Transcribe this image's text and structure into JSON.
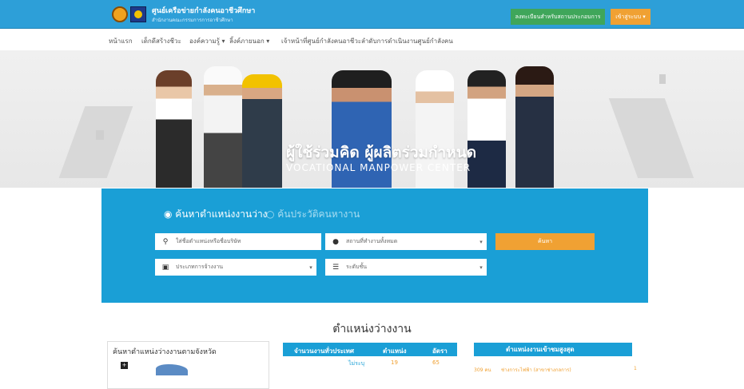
{
  "header": {
    "title": "ศูนย์เครือข่ายกำลังคนอาชีวศึกษา",
    "subtitle": "สำนักงานคณะกรรมการการอาชีวศึกษา",
    "register_label": "ลงทะเบียนสำหรับสถานประกอบการ",
    "login_label": "เข้าสู่ระบบ ▾"
  },
  "nav": {
    "items": [
      {
        "label": "หน้าแรก"
      },
      {
        "label": "เด็กดีสร้างชีวะ"
      },
      {
        "label": "องค์ความรู้ ▾"
      },
      {
        "label": "ลิ้งค์ภายนอก ▾"
      },
      {
        "label": "เจ้าหน้าที่ศูนย์กำลังคนอาชีวะ"
      },
      {
        "label": "ลำดับการดำเนินงานศูนย์กำลังคน"
      }
    ]
  },
  "hero": {
    "headline": "ผู้ใช้ร่วมคิด ผู้ผลิตร่วมกำหนด",
    "subheadline": "VOCATIONAL MANPOWER CENTER"
  },
  "search": {
    "mode_active": "◉ ค้นหาตำแหน่งงานว่าง",
    "mode_inactive": "○ ค้นประวัติคนหางาน",
    "keyword_placeholder": "ใส่ชื่อตำแหน่งหรือชื่อบริษัท",
    "location_value": "สถานที่ทำงานทั้งหมด",
    "employment_type_value": "ประเภทการจ้างงาน",
    "level_value": "ระดับชั้น",
    "submit_label": "ค้นหา"
  },
  "section": {
    "title": "ตำแหน่งว่างงาน"
  },
  "province": {
    "title": "ค้นหาตำแหน่งว่างงานตามจังหวัด",
    "zoom_label": "+"
  },
  "stats": {
    "headers": [
      "จำนวนงานทั่วประเทศ",
      "ตำแหน่ง",
      "อัตรา"
    ],
    "rows": [
      {
        "label": "ไม่ระบุ",
        "positions": "19",
        "rate": "65"
      }
    ]
  },
  "popular": {
    "title": "ตำแหน่งงานเข้าชมสูงสุด",
    "rows": [
      {
        "count": "309 คน",
        "name": "ช่างการะไฟฟ้า (สาขาช่างกลการ)",
        "rank": "1"
      }
    ]
  },
  "colors": {
    "primary_blue": "#1a9fd6",
    "header_blue": "#2d9fd8",
    "accent_orange": "#f0a133",
    "register_green": "#3fa65a"
  }
}
